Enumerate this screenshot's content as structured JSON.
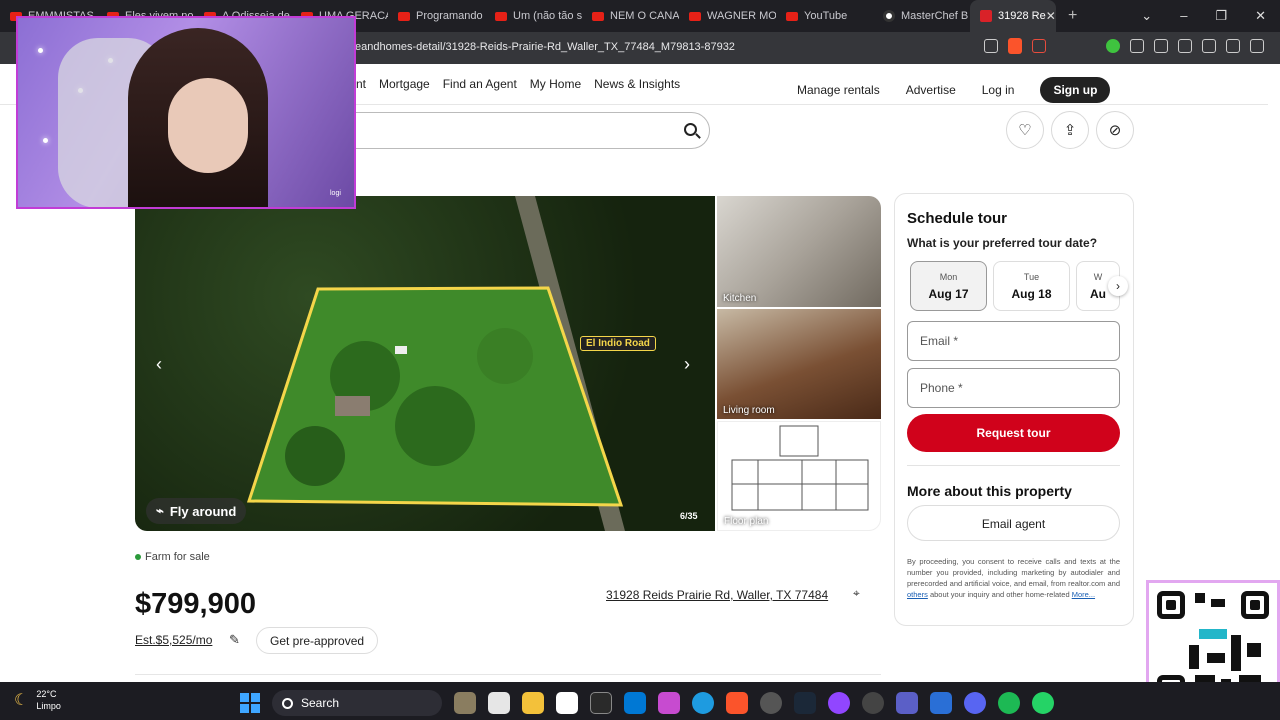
{
  "browser": {
    "tabs": [
      {
        "label": "EMMMISTAS",
        "type": "yt"
      },
      {
        "label": "Eles vivem no",
        "type": "yt"
      },
      {
        "label": "A Odisseia de",
        "type": "yt"
      },
      {
        "label": "UMA GERACA",
        "type": "yt"
      },
      {
        "label": "Programando",
        "type": "yt"
      },
      {
        "label": "Um (não tão s",
        "type": "yt"
      },
      {
        "label": "NEM O CANA",
        "type": "yt"
      },
      {
        "label": "WAGNER MO",
        "type": "yt"
      },
      {
        "label": "YouTube",
        "type": "yt"
      },
      {
        "label": "MasterChef B",
        "type": "mc"
      },
      {
        "label": "31928 Re",
        "type": "rl",
        "active": true
      }
    ],
    "new_tab": "+",
    "url": "eandhomes-detail/31928-Reids-Prairie-Rd_Waller_TX_77484_M79813-87932"
  },
  "site": {
    "nav": [
      "nt",
      "Mortgage",
      "Find an Agent",
      "My Home",
      "News & Insights"
    ],
    "nav_right": [
      "Manage rentals",
      "Advertise",
      "Log in"
    ],
    "signup": "Sign up"
  },
  "gallery": {
    "road_label": "El Indio Road",
    "fly_around": "Fly around",
    "counter": "6/35",
    "thumbs": [
      "Kitchen",
      "Living room",
      "Floor plan"
    ]
  },
  "listing": {
    "status": "Farm for sale",
    "price": "$799,900",
    "estimate": "Est.$5,525/mo",
    "preapproved": "Get pre-approved",
    "address": "31928 Reids Prairie Rd, Waller, TX 77484"
  },
  "tour": {
    "title": "Schedule tour",
    "subtitle": "What is your preferred tour date?",
    "dates": [
      {
        "dow": "Mon",
        "date": "Aug 17",
        "selected": true
      },
      {
        "dow": "Tue",
        "date": "Aug 18",
        "selected": false
      },
      {
        "dow": "W",
        "date": "Au",
        "selected": false
      }
    ],
    "email_placeholder": "Email *",
    "phone_placeholder": "Phone *",
    "request_label": "Request tour",
    "more_title": "More about this property",
    "email_agent": "Email agent",
    "disclaimer_pre": "By proceeding, you consent to receive calls and texts at the number you provided, including marketing by autodialer and prerecorded and artificial voice, and email, from realtor.com and ",
    "disclaimer_link1": "others",
    "disclaimer_mid": " about your inquiry and other home-related ",
    "disclaimer_link2": "More..."
  },
  "overlay": {
    "webcam_tag": "logi"
  },
  "taskbar": {
    "temp": "22°C",
    "condition": "Limpo",
    "search": "Search"
  },
  "colors": {
    "brand_red": "#d0021b",
    "accent_yellow": "#f4d64a",
    "status_green": "#2b9a3a"
  }
}
